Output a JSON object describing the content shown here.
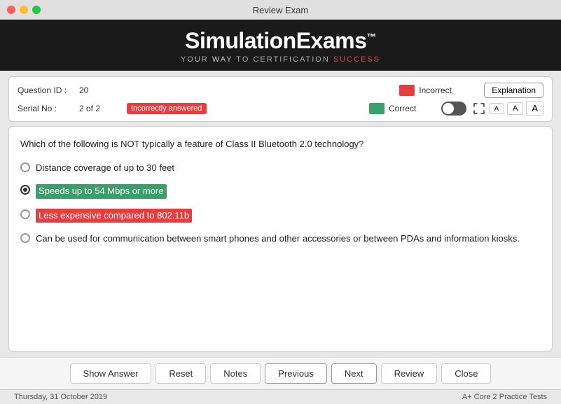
{
  "window": {
    "title": "Review Exam"
  },
  "header": {
    "title": "SimulationExams",
    "tm": "™",
    "tagline_pre": "YOUR ",
    "tagline_way": "WAY",
    "tagline_mid": " TO CERTIFICATION ",
    "tagline_success": "SUCCESS"
  },
  "info": {
    "question_id_label": "Question ID :",
    "question_id_value": "20",
    "serial_label": "Serial No :",
    "serial_value": "2 of 2",
    "incorrectly_answered": "Incorrectly answered",
    "incorrect_label": "Incorrect",
    "correct_label": "Correct",
    "explanation_label": "Explanation",
    "font_labels": [
      "A",
      "A",
      "A"
    ]
  },
  "question": {
    "text": "Which of the following is NOT typically a feature of Class II Bluetooth 2.0 technology?",
    "options": [
      {
        "id": "opt1",
        "text": "Distance coverage of up to 30 feet",
        "highlight": "none",
        "selected": false
      },
      {
        "id": "opt2",
        "text": "Speeds up to 54 Mbps or more",
        "highlight": "green",
        "selected": true
      },
      {
        "id": "opt3",
        "text": "Less expensive compared to 802.11b",
        "highlight": "red",
        "selected": false
      },
      {
        "id": "opt4",
        "text": "Can be used for communication between smart phones and other accessories or between PDAs and information kiosks.",
        "highlight": "none",
        "selected": false
      }
    ]
  },
  "buttons": {
    "show_answer": "Show Answer",
    "reset": "Reset",
    "notes": "Notes",
    "previous": "Previous",
    "next": "Next",
    "review": "Review",
    "close": "Close"
  },
  "footer": {
    "date": "Thursday, 31 October 2019",
    "product": "A+ Core 2 Practice Tests"
  }
}
